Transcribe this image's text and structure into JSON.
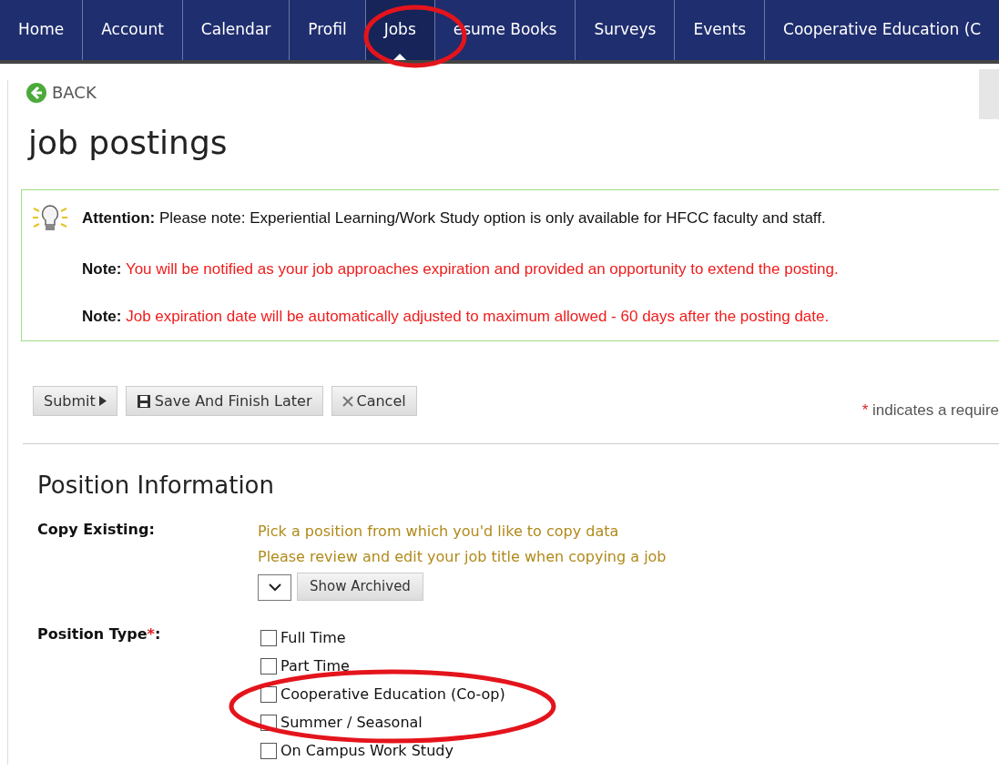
{
  "nav": {
    "tabs": [
      {
        "label": "Home",
        "selected": false
      },
      {
        "label": "Account",
        "selected": false
      },
      {
        "label": "Calendar",
        "selected": false
      },
      {
        "label": "Profil",
        "selected": false
      },
      {
        "label": "Jobs",
        "selected": true
      },
      {
        "label": "esume Books",
        "selected": false
      },
      {
        "label": "Surveys",
        "selected": false
      },
      {
        "label": "Events",
        "selected": false
      },
      {
        "label": "Cooperative Education (C",
        "selected": false
      }
    ]
  },
  "back": "BACK",
  "title": "job postings",
  "notice": {
    "lines": [
      {
        "label": "Attention:",
        "text": "Please note: Experiential Learning/Work Study option is only available for HFCC faculty and staff.",
        "kind": "plain"
      },
      {
        "label": "Note:",
        "text": "You will be notified as your job approaches expiration and provided an opportunity to extend the posting.",
        "kind": "alert"
      },
      {
        "label": "Note:",
        "text": "Job expiration date will be automatically adjusted to maximum allowed - 60 days after the posting date.",
        "kind": "alert"
      }
    ]
  },
  "actions": [
    {
      "label": "Submit",
      "kind": "submit"
    },
    {
      "label": "Save And Finish Later",
      "kind": "save"
    },
    {
      "label": "Cancel",
      "kind": "cancel"
    }
  ],
  "required_note": {
    "mark": "*",
    "text": "indicates a require"
  },
  "section": {
    "title": "Position Information",
    "copy_existing": {
      "label": "Copy Existing:",
      "hints": [
        "Pick a position from which you'd like to copy data",
        "Please review and edit your job title when copying a job"
      ],
      "button": "Show Archived"
    },
    "position_type": {
      "label": "Position Type",
      "required_mark": "*",
      "suffix": ":",
      "options": [
        {
          "label": "Full Time",
          "checked": false
        },
        {
          "label": "Part Time",
          "checked": false
        },
        {
          "label": "Cooperative Education (Co-op)",
          "checked": false
        },
        {
          "label": "Summer / Seasonal",
          "checked": false
        },
        {
          "label": "On Campus Work Study",
          "checked": false
        }
      ]
    }
  }
}
